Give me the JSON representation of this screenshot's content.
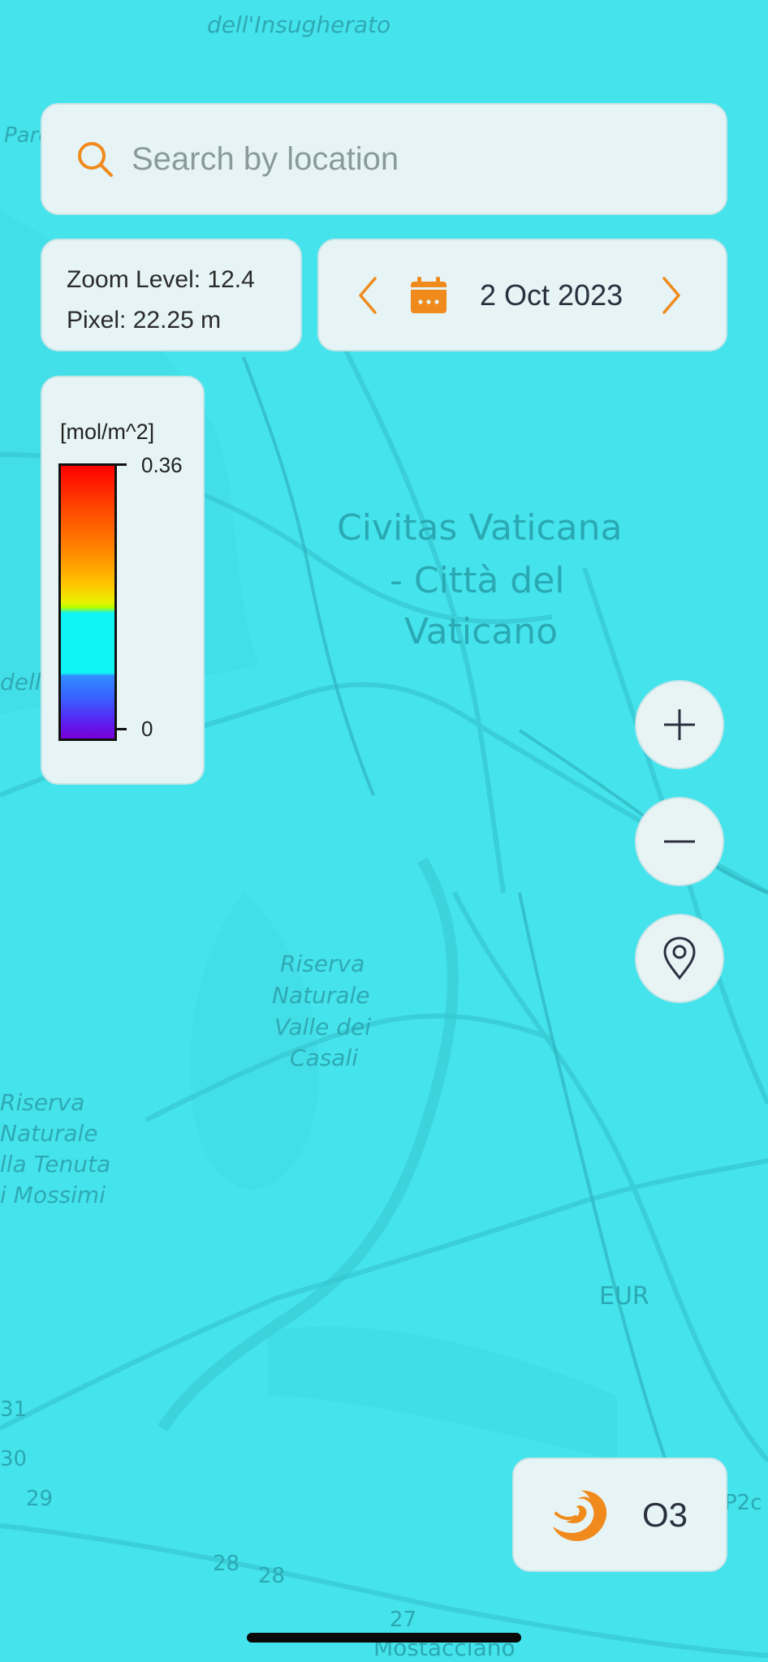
{
  "search": {
    "placeholder": "Search by location"
  },
  "zoom_info": {
    "zoom_level": "Zoom Level: 12.4",
    "pixel_size": "Pixel: 22.25 m"
  },
  "date_picker": {
    "date": "2 Oct 2023"
  },
  "legend": {
    "unit": "[mol/m^2]",
    "max": "0.36",
    "min": "0"
  },
  "pollutant": {
    "label": "O3",
    "icon": "swirl-icon",
    "accent_color": "#f08a1c"
  },
  "map_labels": {
    "insugherato": "dell'Insugherato",
    "parco": "Parco naturale",
    "vaticana_1": "Civitas Vaticana",
    "vaticana_2": "- Città del",
    "vaticana_3": "Vaticano",
    "riserva_casali_1": "Riserva",
    "riserva_casali_2": "Naturale",
    "riserva_casali_3": "Valle dei",
    "riserva_casali_4": "Casali",
    "riserva_mossimi_1": "Riserva",
    "riserva_mossimi_2": "Naturale",
    "riserva_mossimi_3": "lla Tenuta",
    "riserva_mossimi_4": "i Mossimi",
    "eur": "EUR",
    "mostacciano": "Mostacciano",
    "dell": "dell'",
    "road_28a": "28",
    "road_28b": "28",
    "road_27": "27",
    "road_29": "29",
    "road_30": "30",
    "road_31": "31",
    "p2c": "P2c"
  },
  "colors": {
    "map_tint": "#45e3ec",
    "card_bg": "#e6f4f5",
    "accent": "#f08a1c"
  }
}
